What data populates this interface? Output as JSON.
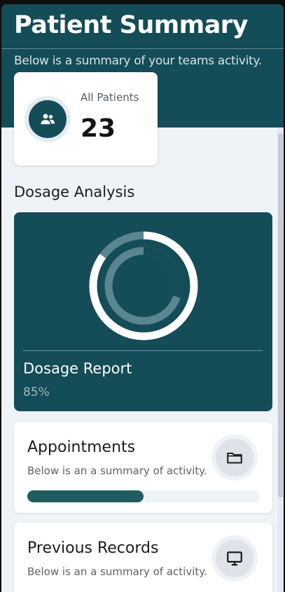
{
  "header": {
    "title": "Patient Summary",
    "subtitle": "Below is a summary of your teams activity."
  },
  "patients_card": {
    "label": "All Patients",
    "count": "23",
    "icon": "users-icon"
  },
  "dosage": {
    "section_title": "Dosage Analysis",
    "report_title": "Dosage Report",
    "value_text": "85%",
    "outer_ring_fraction": 0.85,
    "inner_ring_fraction": 0.3
  },
  "appointments": {
    "title": "Appointments",
    "subtitle": "Below is an a summary of activity.",
    "icon": "folder-icon",
    "progress_fraction": 0.5
  },
  "previous_records": {
    "title": "Previous Records",
    "subtitle": "Below is an a summary of activity.",
    "icon": "monitor-icon"
  },
  "colors": {
    "primary": "#144c58",
    "background": "#eff3f8",
    "progress": "#1f5d5f"
  }
}
